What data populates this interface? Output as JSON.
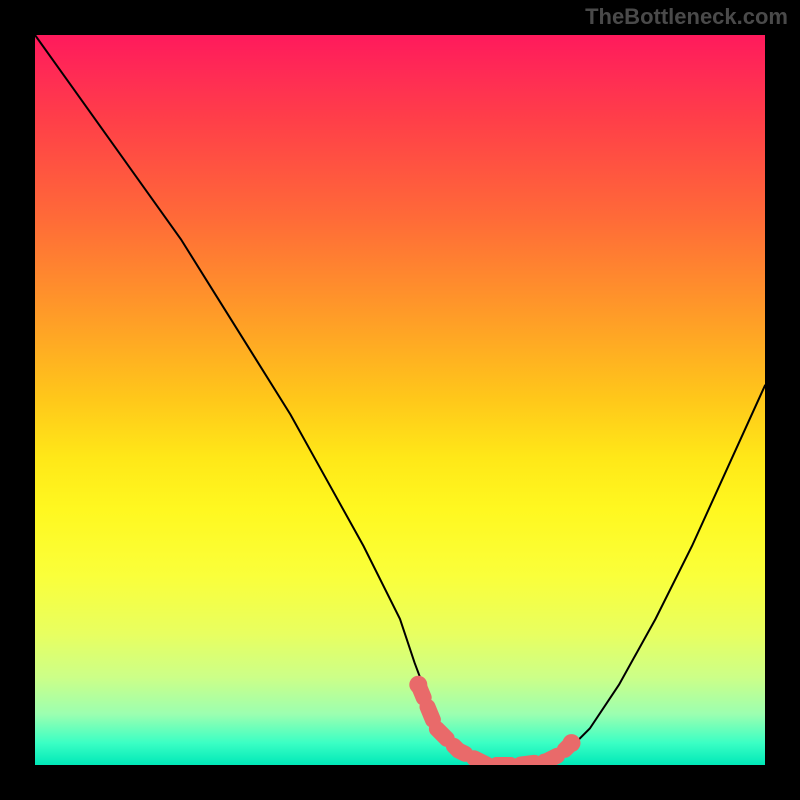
{
  "watermark": "TheBottleneck.com",
  "chart_data": {
    "type": "line",
    "title": "",
    "xlabel": "",
    "ylabel": "",
    "xlim": [
      0,
      100
    ],
    "ylim": [
      0,
      100
    ],
    "series": [
      {
        "name": "bottleneck-curve",
        "x": [
          0,
          5,
          10,
          15,
          20,
          25,
          30,
          35,
          40,
          45,
          50,
          52,
          55,
          58,
          62,
          66,
          70,
          72,
          76,
          80,
          85,
          90,
          95,
          100
        ],
        "y": [
          100,
          93,
          86,
          79,
          72,
          64,
          56,
          48,
          39,
          30,
          20,
          14,
          6,
          2,
          0,
          0,
          0,
          1,
          5,
          11,
          20,
          30,
          41,
          52
        ]
      }
    ],
    "highlight": {
      "name": "optimal-range-dots",
      "x": [
        52.5,
        55,
        58,
        62,
        66,
        70,
        72,
        73.5
      ],
      "y": [
        11,
        5,
        2,
        0,
        0,
        0.5,
        1.5,
        3
      ]
    },
    "gradient": {
      "top_color": "#ff1a5c",
      "mid_color": "#ffe818",
      "bottom_color": "#00e8b8"
    }
  }
}
